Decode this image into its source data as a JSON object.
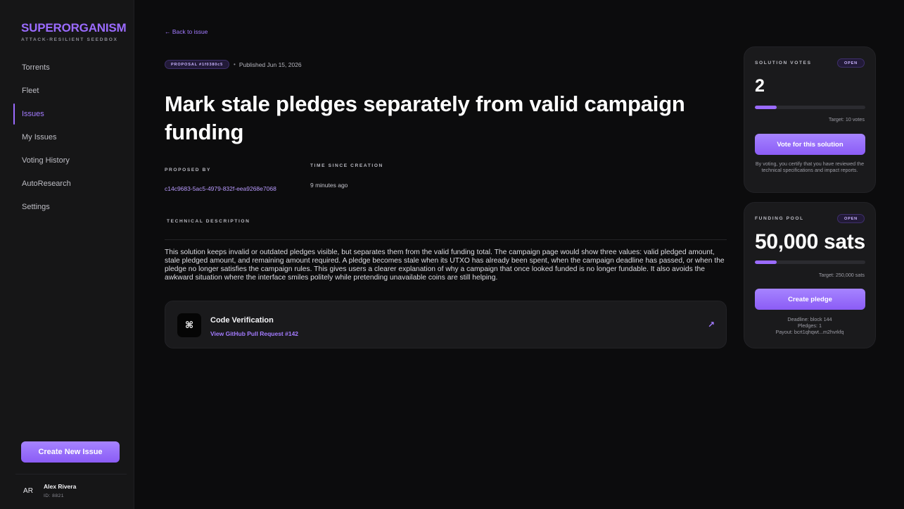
{
  "brand": {
    "title": "SUPERORGANISM",
    "subtitle": "ATTACK-RESILIENT SEEDBOX"
  },
  "nav": {
    "items": [
      {
        "label": "Torrents"
      },
      {
        "label": "Fleet"
      },
      {
        "label": "Issues"
      },
      {
        "label": "My Issues"
      },
      {
        "label": "Voting History"
      },
      {
        "label": "AutoResearch"
      },
      {
        "label": "Settings"
      }
    ],
    "active": "Issues"
  },
  "sidebar": {
    "create_label": "Create New Issue"
  },
  "user": {
    "initials": "AR",
    "name": "Alex Rivera",
    "id": "ID: 8821"
  },
  "main": {
    "back_label": "← Back to issue",
    "proposal_pill": "PROPOSAL #1f0380c5",
    "dot": "•",
    "published": "Published Jun 15, 2026",
    "title": "Mark stale pledges separately from valid campaign funding",
    "proposed_by_label": "PROPOSED BY",
    "proposer": "c14c9683-5ac5-4979-832f-eea9268e7068",
    "time_label": "TIME SINCE CREATION",
    "time_value": "9 minutes ago",
    "tech_label": "TECHNICAL DESCRIPTION",
    "description": "This solution keeps invalid or outdated pledges visible, but separates them from the valid funding total. The campaign page would show three values: valid pledged amount, stale pledged amount, and remaining amount required. A pledge becomes stale when its UTXO has already been spent, when the campaign deadline has passed, or when the pledge no longer satisfies the campaign rules. This gives users a clearer explanation of why a campaign that once looked funded is no longer fundable. It also avoids the awkward situation where the interface smiles politely while pretending unavailable coins are still helping.",
    "code_card": {
      "icon_glyph": "⌘",
      "title": "Code Verification",
      "link": "View GitHub Pull Request #142",
      "arrow": "↗"
    }
  },
  "votes": {
    "label": "SOLUTION VOTES",
    "status": "OPEN",
    "count": "2",
    "progress_fraction": 0.2,
    "target": "Target: 10 votes",
    "cta": "Vote for this solution",
    "note": "By voting, you certify that you have reviewed the technical specifications and impact reports."
  },
  "pool": {
    "label": "FUNDING POOL",
    "status": "OPEN",
    "amount": "50,000 sats",
    "progress_fraction": 0.2,
    "target": "Target: 250,000 sats",
    "cta": "Create pledge",
    "deadline": "Deadline: block 144",
    "pledges": "Pledges: 1",
    "payout": "Payout: bcrt1qhqwt...m2hvrkfq"
  },
  "colors": {
    "accent": "#9b6bff",
    "background": "#0c0c0d",
    "panel": "#1a1a1c"
  }
}
